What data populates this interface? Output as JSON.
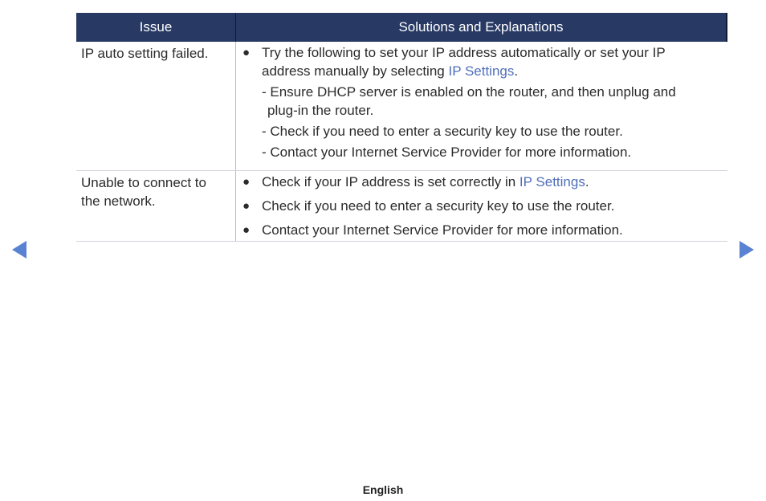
{
  "table": {
    "headers": {
      "issue": "Issue",
      "solutions": "Solutions and Explanations"
    },
    "rows": [
      {
        "issue": "IP auto setting failed.",
        "bullet": {
          "text": "Try the following to set your IP address automatically or set your IP address manually by selecting ",
          "link": "IP Settings",
          "after": "."
        },
        "subs": [
          {
            "line1": "- Ensure DHCP server is enabled on the router, and then unplug and",
            "line2": "plug-in the router."
          },
          {
            "line1": "- Check if you need to enter a security key to use the router."
          },
          {
            "line1": "- Contact your Internet Service Provider for more information."
          }
        ]
      },
      {
        "issue_line1": "Unable to connect to",
        "issue_line2": "the network.",
        "bullets": [
          {
            "text": "Check if your IP address is set correctly in ",
            "link": "IP Settings",
            "after": "."
          },
          {
            "text": "Check if you need to enter a security key to use the router."
          },
          {
            "text": "Contact your Internet Service Provider for more information."
          }
        ]
      }
    ]
  },
  "nav": {
    "prev_icon": "triangle-left",
    "next_icon": "triangle-right",
    "accent_color": "#5a82d3"
  },
  "footer": {
    "language": "English"
  },
  "colors": {
    "header_bg": "#283a64",
    "link": "#4f6fba"
  }
}
